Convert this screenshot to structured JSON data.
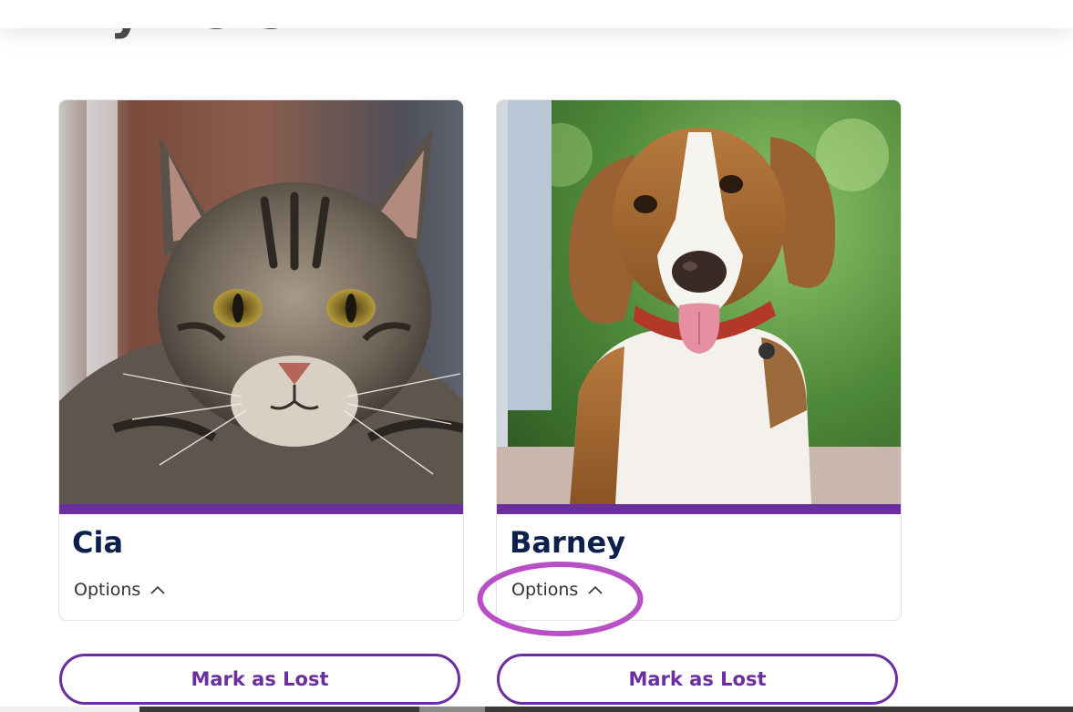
{
  "page": {
    "title": "My Pets"
  },
  "pets": [
    {
      "name": "Cia",
      "photo_subject": "tabby-cat-photo",
      "options_label": "Options",
      "mark_lost_label": "Mark as Lost"
    },
    {
      "name": "Barney",
      "photo_subject": "beagle-dog-photo",
      "options_label": "Options",
      "mark_lost_label": "Mark as Lost"
    }
  ],
  "colors": {
    "accent": "#6a2ea0",
    "pet_name": "#0d1f4c",
    "annotation": "#b94fc4"
  },
  "icons": {
    "options_toggle": "chevron-up-icon"
  }
}
